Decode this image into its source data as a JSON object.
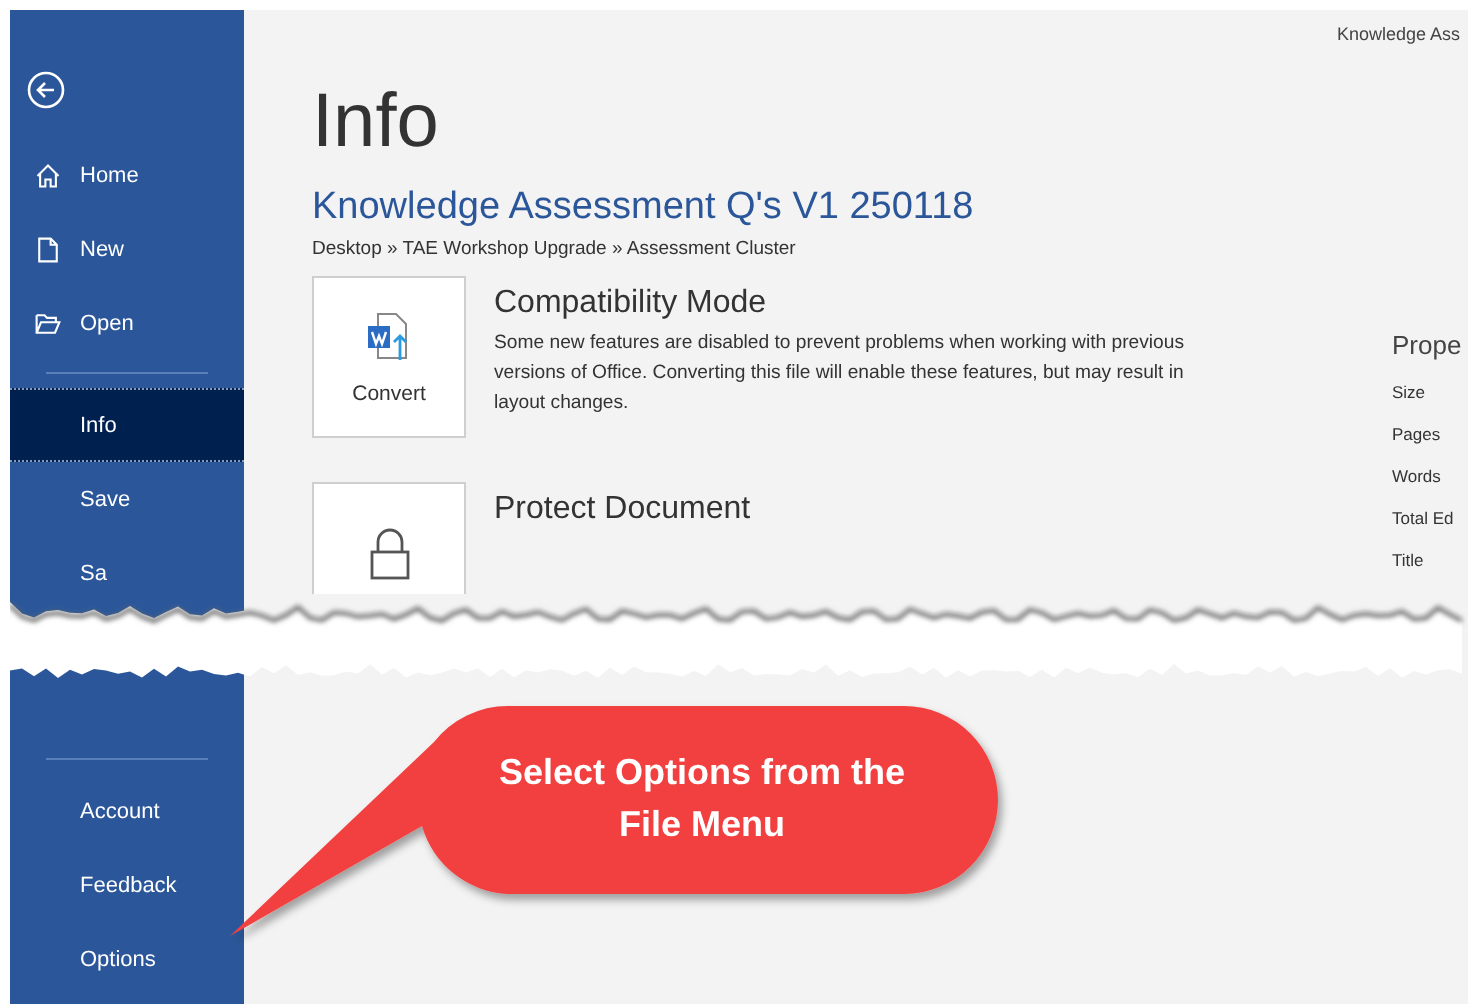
{
  "window_title": "Knowledge Ass",
  "sidebar": {
    "top_items": [
      {
        "kind": "home",
        "label": "Home",
        "selected": false
      },
      {
        "kind": "new",
        "label": "New",
        "selected": false
      },
      {
        "kind": "open",
        "label": "Open",
        "selected": false
      },
      {
        "kind": "divider"
      },
      {
        "kind": "plain",
        "label": "Info",
        "selected": true
      },
      {
        "kind": "plain",
        "label": "Save",
        "selected": false
      },
      {
        "kind": "plain",
        "label": "Sa",
        "selected": false
      }
    ],
    "bottom_items": [
      {
        "kind": "divider"
      },
      {
        "kind": "plain",
        "label": "Account",
        "selected": false
      },
      {
        "kind": "plain",
        "label": "Feedback",
        "selected": false
      },
      {
        "kind": "plain",
        "label": "Options",
        "selected": false
      }
    ]
  },
  "page_title": "Info",
  "document_name": "Knowledge Assessment Q's V1 250118",
  "breadcrumb": "Desktop » TAE Workshop Upgrade » Assessment Cluster",
  "sections": [
    {
      "kind": "convert",
      "button": "Convert",
      "heading": "Compatibility Mode",
      "text": "Some new features are disabled to prevent problems when working with previous versions of Office. Converting this file will enable these features, but may result in layout changes."
    },
    {
      "kind": "lock",
      "heading": "Protect Document"
    }
  ],
  "properties": {
    "heading": "Prope",
    "rows": [
      "Size",
      "Pages",
      "Words",
      "Total Ed",
      "Title"
    ]
  },
  "callout": {
    "text": "Select Options from the File Menu"
  }
}
